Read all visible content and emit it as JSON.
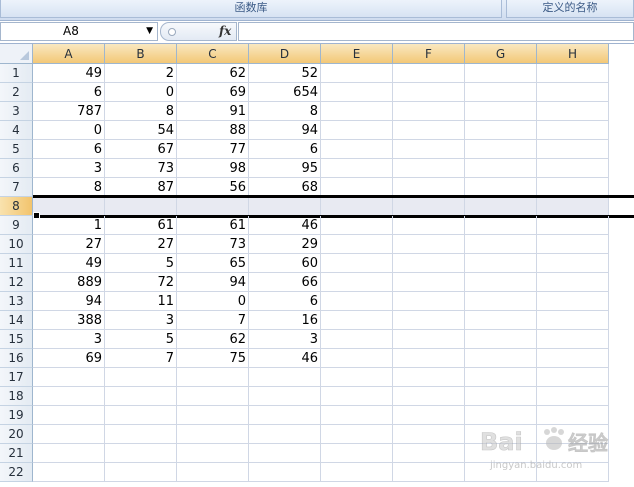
{
  "ribbon": {
    "groups": [
      "函数库",
      "定义的名称"
    ]
  },
  "formula_bar": {
    "name_box": "A8",
    "name_box_arrow": "▼",
    "fx_label": "fx",
    "formula": ""
  },
  "columns": [
    "A",
    "B",
    "C",
    "D",
    "E",
    "F",
    "G",
    "H"
  ],
  "rows": [
    {
      "num": "1",
      "cells": [
        "49",
        "2",
        "62",
        "52"
      ]
    },
    {
      "num": "2",
      "cells": [
        "6",
        "0",
        "69",
        "654"
      ]
    },
    {
      "num": "3",
      "cells": [
        "787",
        "8",
        "91",
        "8"
      ]
    },
    {
      "num": "4",
      "cells": [
        "0",
        "54",
        "88",
        "94"
      ]
    },
    {
      "num": "5",
      "cells": [
        "6",
        "67",
        "77",
        "6"
      ]
    },
    {
      "num": "6",
      "cells": [
        "3",
        "73",
        "98",
        "95"
      ]
    },
    {
      "num": "7",
      "cells": [
        "8",
        "87",
        "56",
        "68"
      ]
    },
    {
      "num": "8",
      "cells": [
        "",
        "",
        "",
        ""
      ],
      "selected": true
    },
    {
      "num": "9",
      "cells": [
        "1",
        "61",
        "61",
        "46"
      ]
    },
    {
      "num": "10",
      "cells": [
        "27",
        "27",
        "73",
        "29"
      ]
    },
    {
      "num": "11",
      "cells": [
        "49",
        "5",
        "65",
        "60"
      ]
    },
    {
      "num": "12",
      "cells": [
        "889",
        "72",
        "94",
        "66"
      ]
    },
    {
      "num": "13",
      "cells": [
        "94",
        "11",
        "0",
        "6"
      ]
    },
    {
      "num": "14",
      "cells": [
        "388",
        "3",
        "7",
        "16"
      ]
    },
    {
      "num": "15",
      "cells": [
        "3",
        "5",
        "62",
        "3"
      ]
    },
    {
      "num": "16",
      "cells": [
        "69",
        "7",
        "75",
        "46"
      ]
    },
    {
      "num": "17",
      "cells": [
        "",
        "",
        "",
        ""
      ]
    },
    {
      "num": "18",
      "cells": [
        "",
        "",
        "",
        ""
      ]
    },
    {
      "num": "19",
      "cells": [
        "",
        "",
        "",
        ""
      ]
    },
    {
      "num": "20",
      "cells": [
        "",
        "",
        "",
        ""
      ]
    },
    {
      "num": "21",
      "cells": [
        "",
        "",
        "",
        ""
      ]
    },
    {
      "num": "22",
      "cells": [
        "",
        "",
        "",
        ""
      ]
    }
  ],
  "watermark": {
    "brand_a": "Bai",
    "brand_b": "经验",
    "site": "jingyan.baidu.com"
  },
  "colors": {
    "selected_row": "#e8eaf2",
    "column_header": "#f3c877",
    "grid": "#d0d7e5"
  }
}
